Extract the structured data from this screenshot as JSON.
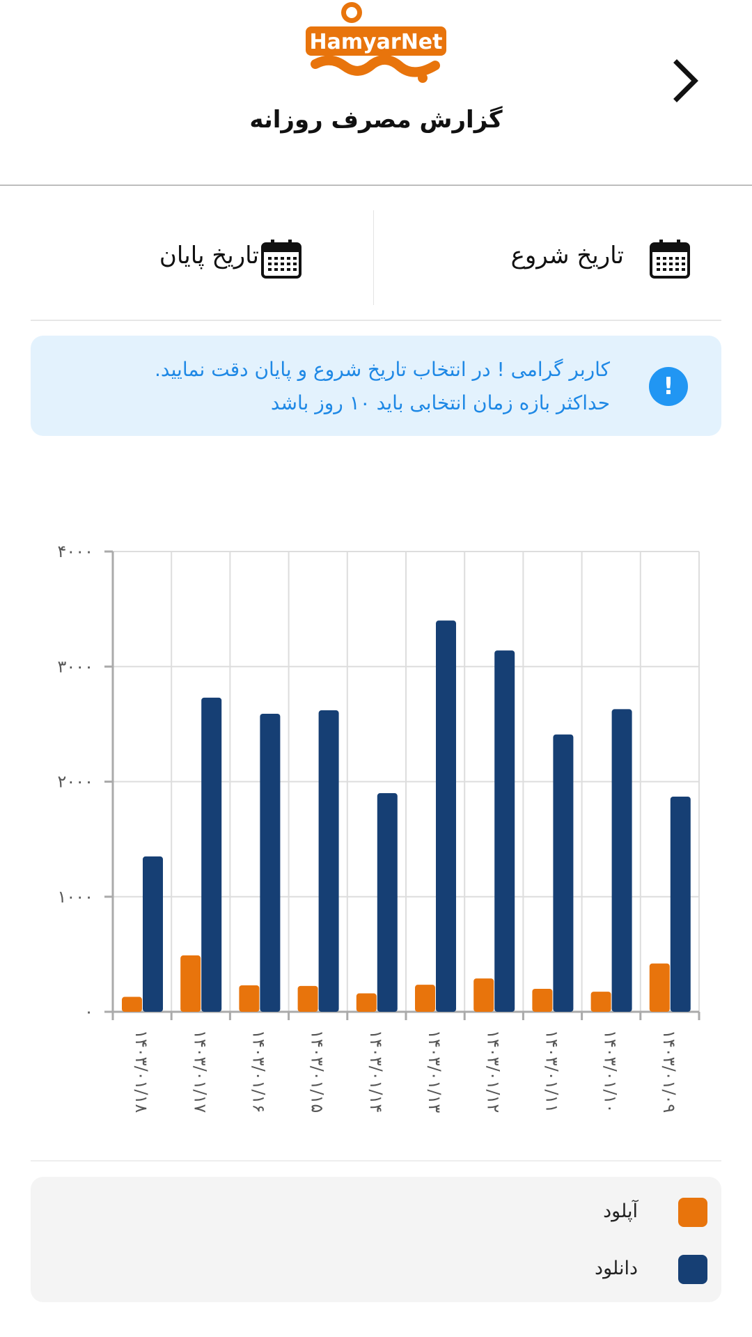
{
  "header": {
    "logo_text": "HamyarNet همیارنت",
    "title": "گزارش مصرف روزانه",
    "back_icon": "chevron-right-icon"
  },
  "date_filters": {
    "start_label": "تاریخ شروع",
    "end_label": "تاریخ پایان",
    "icon": "calendar-icon"
  },
  "alert": {
    "icon": "exclamation-icon",
    "line1": "کاربر گرامی ! در انتخاب تاریخ شروع و پایان دقت نمایید.",
    "line2": "حداکثر بازه زمان انتخابی باید ۱۰ روز باشد",
    "color": "#1e88e5"
  },
  "chart_data": {
    "type": "bar",
    "categories": [
      "۱۴۰۳/۰۱/۱۸",
      "۱۴۰۳/۰۱/۱۷",
      "۱۴۰۳/۰۱/۱۶",
      "۱۴۰۳/۰۱/۱۵",
      "۱۴۰۳/۰۱/۱۴",
      "۱۴۰۳/۰۱/۱۳",
      "۱۴۰۳/۰۱/۱۲",
      "۱۴۰۳/۰۱/۱۱",
      "۱۴۰۳/۰۱/۱۰",
      "۱۴۰۳/۰۱/۰۹"
    ],
    "series": [
      {
        "name": "آپلود",
        "color": "#e8740c",
        "values": [
          130,
          490,
          230,
          225,
          160,
          235,
          290,
          200,
          175,
          420
        ]
      },
      {
        "name": "دانلود",
        "color": "#163f74",
        "values": [
          1350,
          2730,
          2590,
          2620,
          1900,
          3400,
          3140,
          2410,
          2630,
          1870
        ]
      }
    ],
    "y_ticks": [
      "۰",
      "۱۰۰۰",
      "۲۰۰۰",
      "۳۰۰۰",
      "۴۰۰۰"
    ],
    "ylim": [
      0,
      4000
    ],
    "grid": true
  },
  "legend": {
    "items": [
      {
        "label": "آپلود",
        "color": "#e8740c"
      },
      {
        "label": "دانلود",
        "color": "#163f74"
      }
    ]
  }
}
